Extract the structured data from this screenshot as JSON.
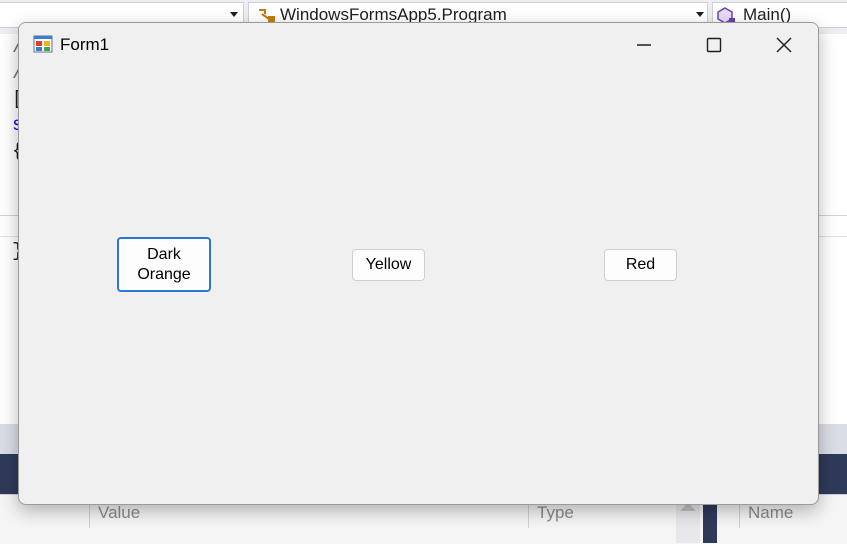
{
  "ide": {
    "nav_class_label": "WindowsFormsApp5.Program",
    "nav_method_label": "Main()",
    "code_glyphs": [
      "/",
      "/",
      "[",
      "s",
      "{",
      "}"
    ],
    "watch_columns": {
      "value": "Value",
      "type": "Type",
      "name": "Name"
    }
  },
  "form": {
    "title": "Form1",
    "buttons": {
      "dark_orange": "Dark Orange",
      "yellow": "Yellow",
      "red": "Red"
    }
  },
  "colors": {
    "focus_border": "#2a78d6",
    "keyword_blue": "#0000ff",
    "ide_dark_band": "#2f3a5a"
  }
}
